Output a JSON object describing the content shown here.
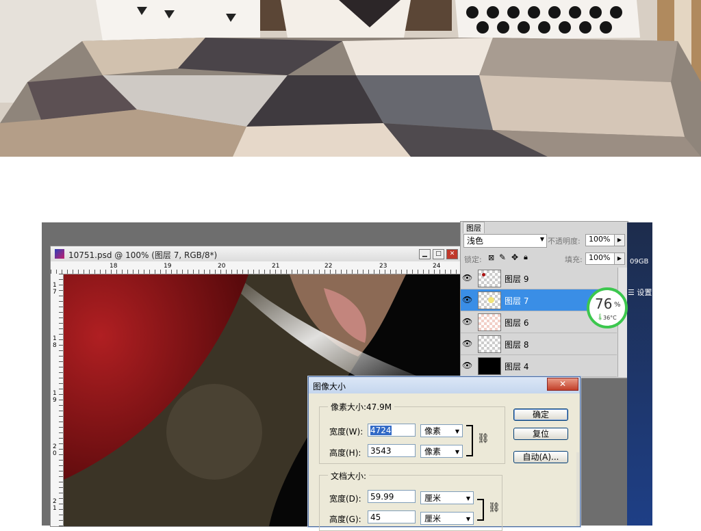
{
  "doc": {
    "title": "10751.psd @ 100% (图层 7, RGB/8*)",
    "ruler_h": [
      "18",
      "19",
      "20",
      "21",
      "22",
      "23",
      "24"
    ],
    "ruler_v": [
      "1\n7",
      "1\n8",
      "1\n9",
      "2\n0",
      "2\n1"
    ]
  },
  "layers": {
    "tab": "图层",
    "blend_mode": "浅色",
    "opacity_label": "不透明度:",
    "opacity_value": "100%",
    "lock_label": "锁定:",
    "fill_label": "填充:",
    "fill_value": "100%",
    "items": [
      {
        "name": "图层 9"
      },
      {
        "name": "图层 7"
      },
      {
        "name": "图层 6"
      },
      {
        "name": "图层 8"
      },
      {
        "name": "图层 4"
      }
    ]
  },
  "side": {
    "storage": "09GB",
    "settings": "设置"
  },
  "gauge": {
    "value": "76",
    "unit": "%",
    "temp": "36°C"
  },
  "dialog": {
    "title": "图像大小",
    "pixel_group": "像素大小:47.9M",
    "width_label": "宽度(W):",
    "width_value": "4724",
    "height_label": "高度(H):",
    "height_value": "3543",
    "pixel_unit": "像素",
    "doc_group": "文档大小:",
    "doc_width_label": "宽度(D):",
    "doc_width_value": "59.99",
    "doc_height_label": "高度(G):",
    "doc_height_value": "45",
    "doc_unit": "厘米",
    "ok": "确定",
    "reset": "复位",
    "auto": "自动(A)..."
  }
}
